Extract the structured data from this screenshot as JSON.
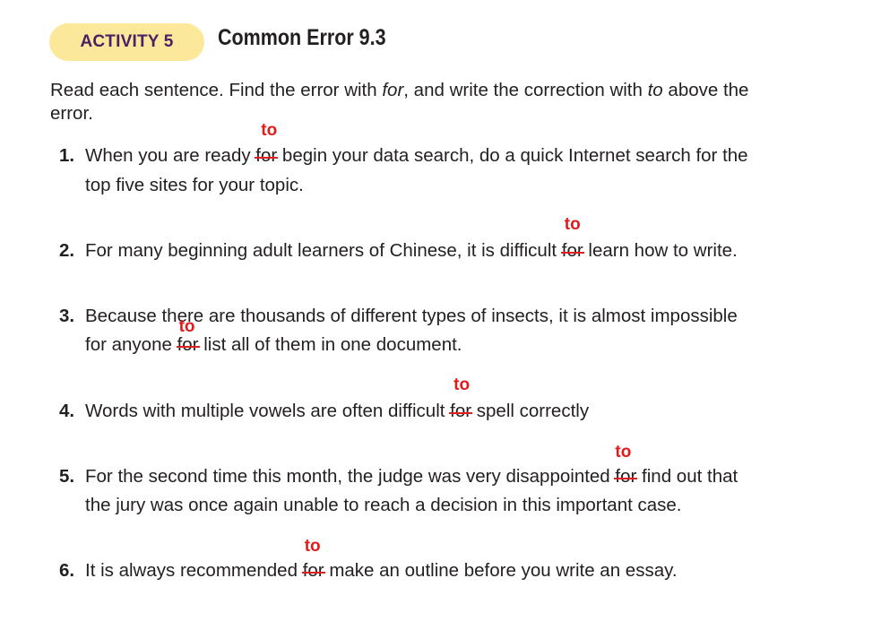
{
  "header": {
    "activity_label": "ACTIVITY 5",
    "title": "Common Error 9.3"
  },
  "instructions": {
    "part1": "Read each sentence. Find the error with ",
    "em1": "for",
    "part2": ", and write the correction with ",
    "em2": "to",
    "part3": " above the",
    "line2": "error."
  },
  "items": [
    {
      "number": "1.",
      "l1_before": "When you are ready ",
      "error": "for",
      "l1_after": " begin your data search, do a quick Internet search for the",
      "l2": "top five sites for your topic.",
      "correction": "to"
    },
    {
      "number": "2.",
      "l1_before": "For many beginning adult learners of Chinese, it is difficult ",
      "error": "for",
      "l1_after": " learn how to write.",
      "correction": "to"
    },
    {
      "number": "3.",
      "l1": "Because there are thousands of different types of insects, it is almost impossible",
      "l2_before": "for anyone ",
      "error": "for",
      "l2_after": " list all of them in one document.",
      "correction": "to"
    },
    {
      "number": "4.",
      "l1_before": "Words with multiple vowels are often difficult ",
      "error": "for",
      "l1_after": " spell correctly",
      "correction": "to"
    },
    {
      "number": "5.",
      "l1_before": "For the second time this month, the judge was very disappointed ",
      "error": "for",
      "l1_after": " find out that",
      "l2": "the jury was once again unable to reach a decision in this important case.",
      "correction": "to"
    },
    {
      "number": "6.",
      "l1_before": "It is always recommended ",
      "error": "for",
      "l1_after": " make an outline before you write an essay.",
      "correction": "to"
    }
  ],
  "colors": {
    "badge_bg": "#fbe89a",
    "badge_text": "#4b2166",
    "correction": "#e31b1b",
    "body_text": "#231f20"
  }
}
